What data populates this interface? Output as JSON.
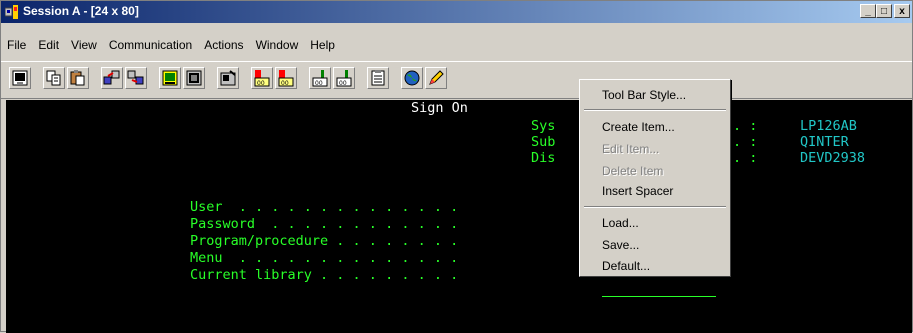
{
  "window": {
    "title": "Session A - [24 x 80]",
    "controls": {
      "minimize": "_",
      "maximize": "□",
      "close": "x"
    }
  },
  "menubar": {
    "items": [
      "File",
      "Edit",
      "View",
      "Communication",
      "Actions",
      "Window",
      "Help"
    ]
  },
  "toolbar": {
    "icons": [
      "print-screen-icon",
      "copy-icon",
      "paste-icon",
      "send-icon",
      "receive-icon",
      "display-icon",
      "keypad-icon",
      "macro-icon",
      "record-icon",
      "play-icon",
      "start-icon",
      "stop-icon",
      "clipboard-icon",
      "web-icon",
      "edit-icon"
    ]
  },
  "terminal": {
    "sign_on": "Sign On",
    "system_label": "Sys",
    "subsystem_label": "Sub",
    "display_label": "Dis",
    "colon1": ". :",
    "colon2": ". :",
    "colon3": ". :",
    "system_value": "LP126AB",
    "subsystem_value": "QINTER",
    "display_value": "DEVD2938",
    "user_label": "User  . . . . . . . . . . . . . .",
    "password_label": "Password  . . . . . . . . . . . .",
    "program_label": "Program/procedure . . . . . . . .",
    "menu_label": "Menu  . . . . . . . . . . . . . .",
    "library_label": "Current library . . . . . . . . ."
  },
  "context_menu": {
    "tool_bar_style": "Tool Bar Style...",
    "create_item": "Create Item...",
    "edit_item": "Edit Item...",
    "delete_item": "Delete Item",
    "insert_spacer": "Insert Spacer",
    "load": "Load...",
    "save": "Save...",
    "default": "Default..."
  },
  "colors": {
    "titlebar_start": "#0a246a",
    "titlebar_end": "#a6caf0",
    "terminal_bg": "#000000",
    "terminal_green": "#28ff28",
    "terminal_white": "#ffffff",
    "terminal_cyan": "#21c7c7"
  }
}
